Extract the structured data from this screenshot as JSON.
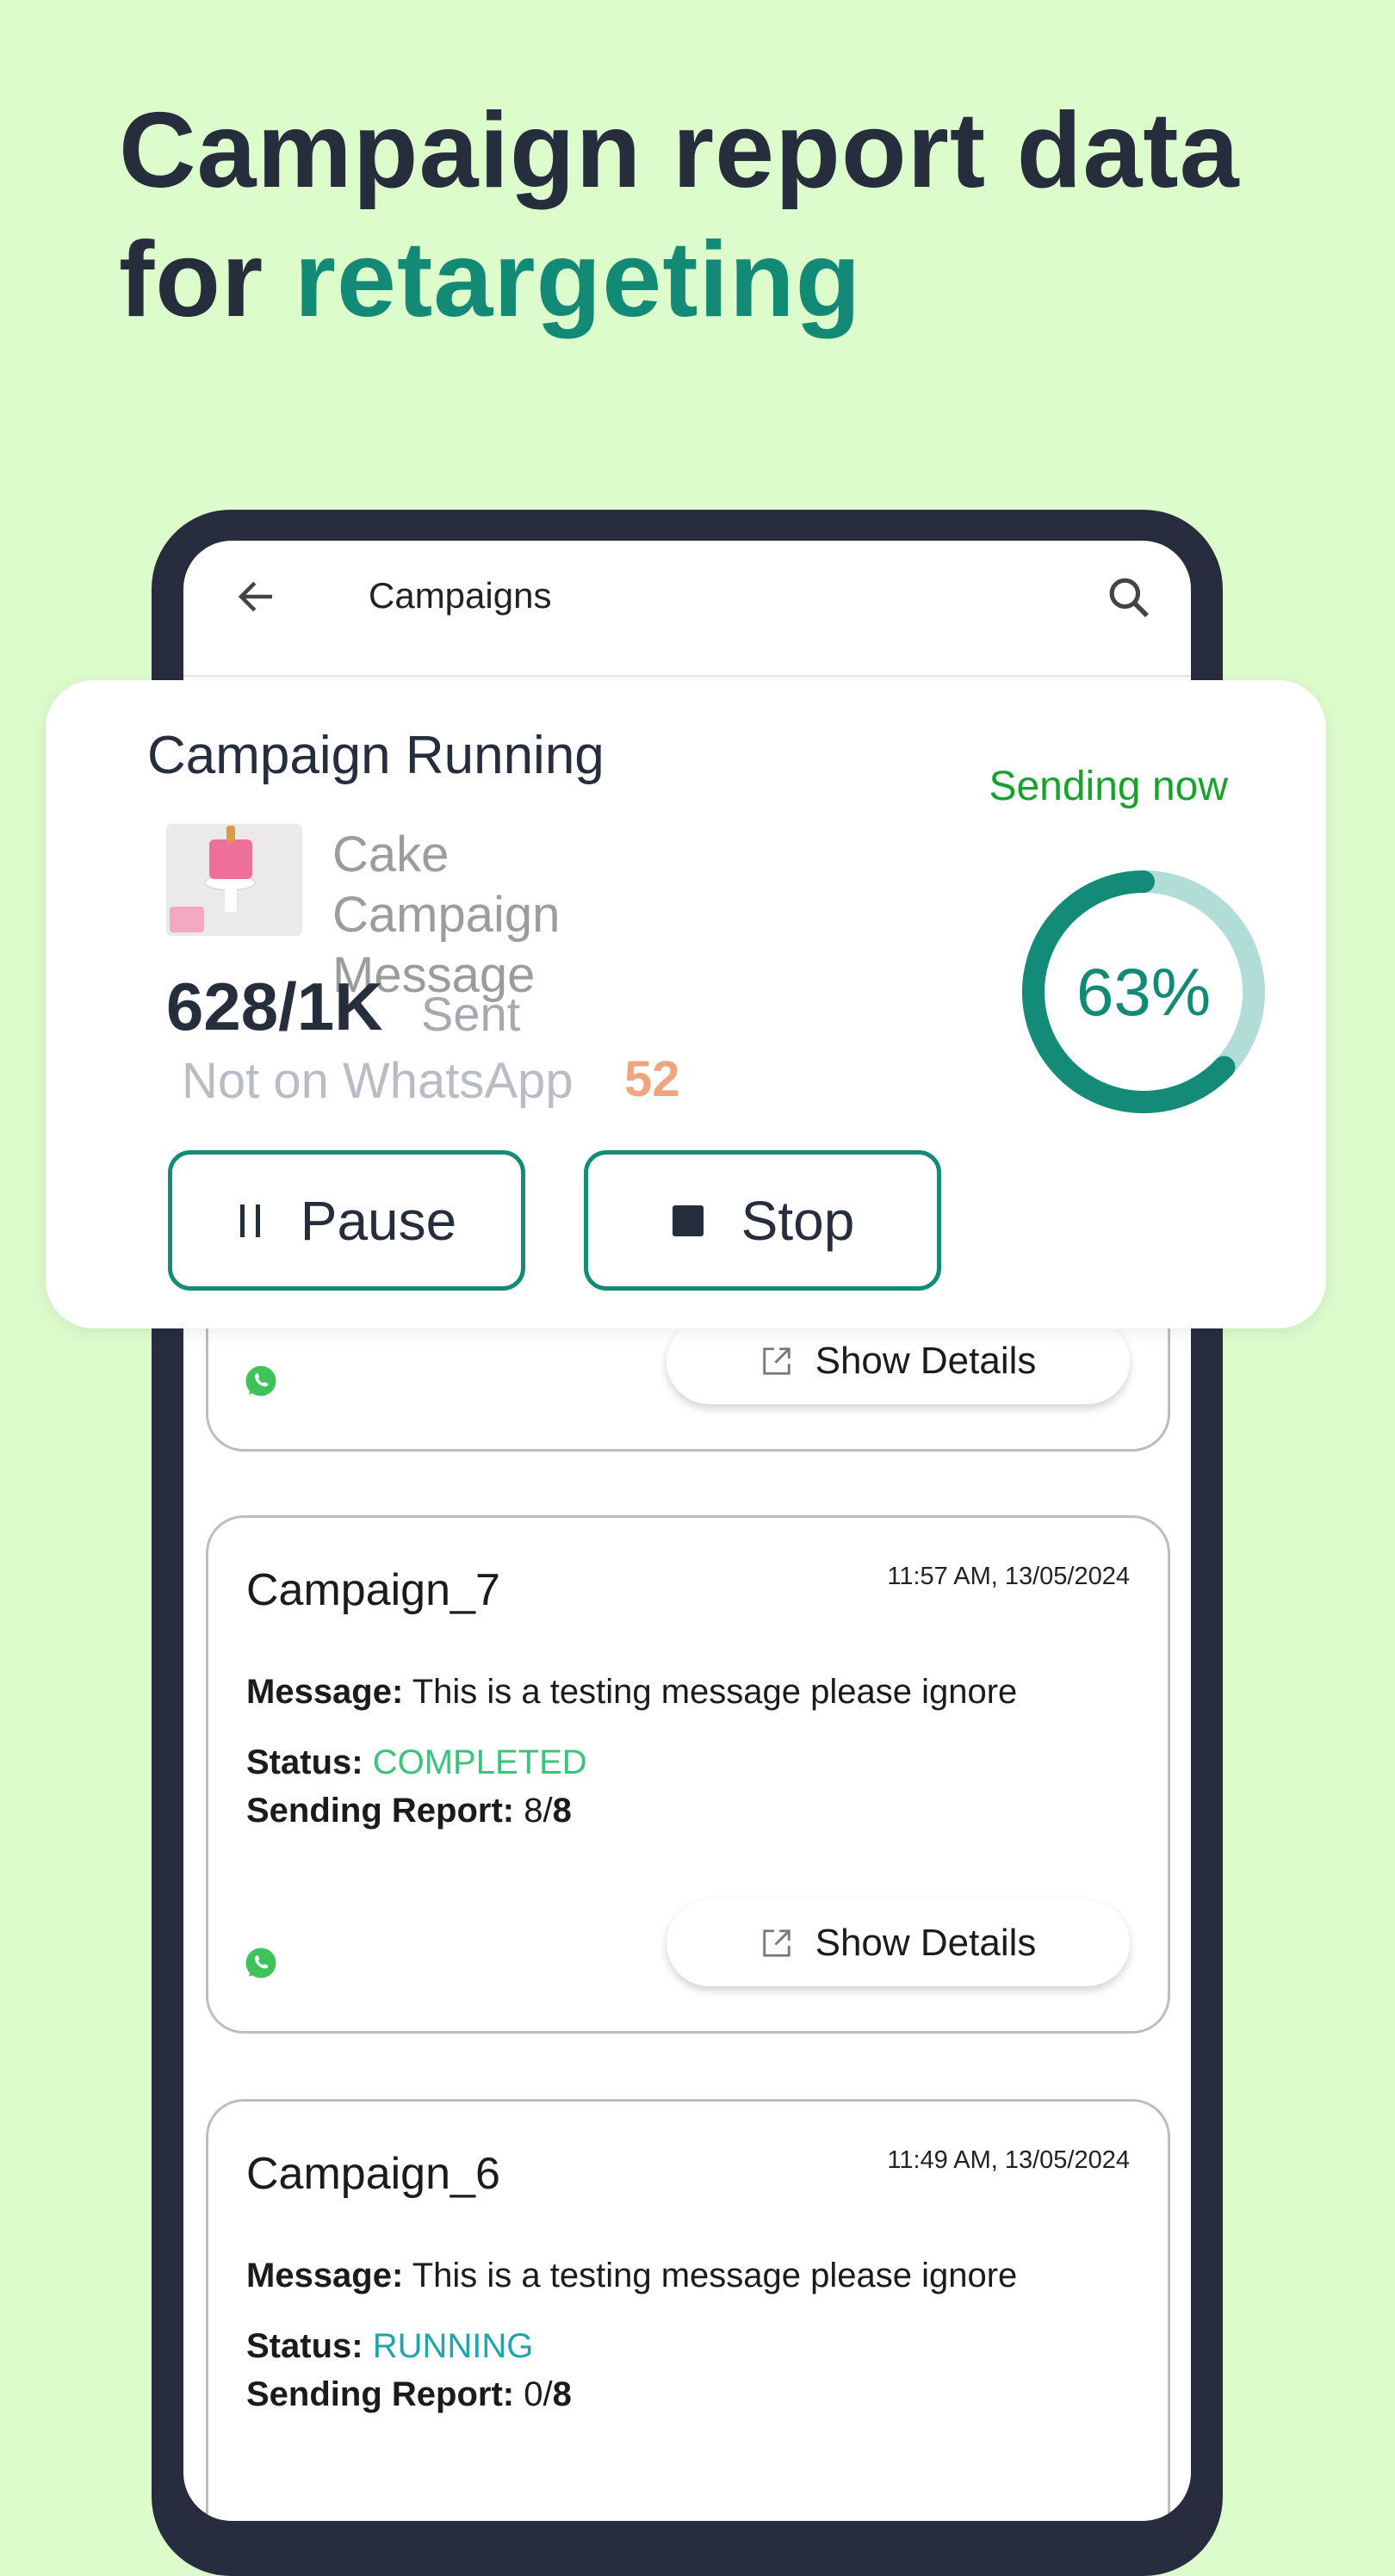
{
  "headline": {
    "line1": "Campaign report data",
    "line2_prefix": "for ",
    "line2_accent": "retargeting"
  },
  "appbar": {
    "title": "Campaigns",
    "back_icon": "arrow-left-icon",
    "search_icon": "search-icon"
  },
  "running_card": {
    "title": "Campaign Running",
    "status": "Sending now",
    "campaign_name": "Cake Campaign Message",
    "sent_count": "628/1K",
    "sent_label": "Sent",
    "not_on_whatsapp_label": "Not on WhatsApp",
    "not_on_whatsapp_value": "52",
    "progress_percent": 63,
    "progress_label": "63%",
    "pause_label": "Pause",
    "stop_label": "Stop"
  },
  "campaigns": [
    {
      "show_details": "Show Details"
    },
    {
      "name": "Campaign_7",
      "time": "11:57 AM, 13/05/2024",
      "message_label": "Message:",
      "message": "This is a testing message please ignore",
      "status_label": "Status:",
      "status": "COMPLETED",
      "report_label": "Sending Report:",
      "report_sent": "8/",
      "report_total": "8",
      "show_details": "Show Details"
    },
    {
      "name": "Campaign_6",
      "time": "11:49 AM, 13/05/2024",
      "message_label": "Message:",
      "message": "This is a testing message please ignore",
      "status_label": "Status:",
      "status": "RUNNING",
      "report_label": "Sending Report:",
      "report_sent": "0/",
      "report_total": "8"
    }
  ],
  "colors": {
    "background": "#dcfccc",
    "accent": "#138a76",
    "completed": "#3cc37a",
    "running": "#1ea6ab",
    "sending": "#17a32a",
    "warning": "#f0a57e"
  }
}
